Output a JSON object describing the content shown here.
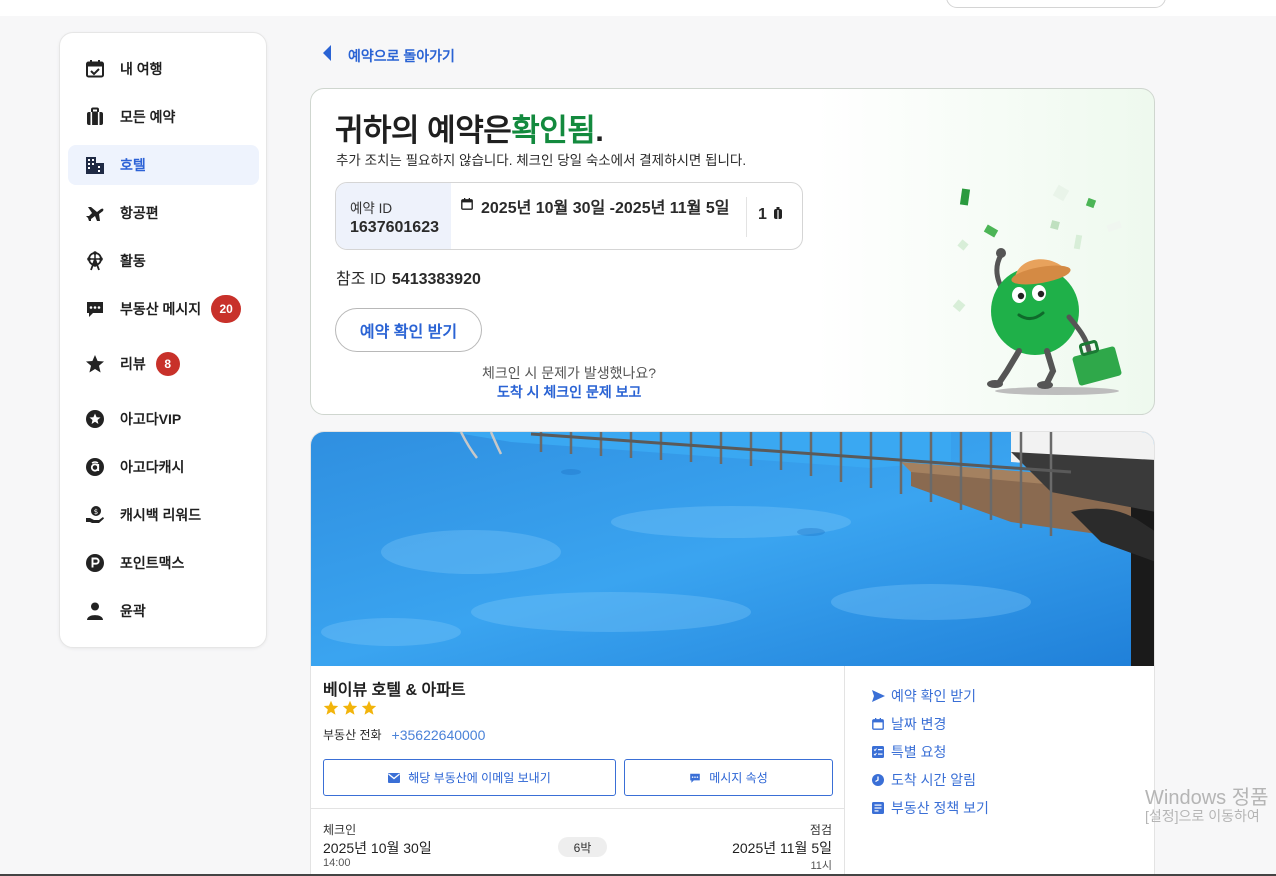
{
  "sidebar": {
    "items": [
      {
        "label": "내 여행",
        "icon": "calendar-check-icon"
      },
      {
        "label": "모든 예약",
        "icon": "suitcase-icon"
      },
      {
        "label": "호텔",
        "icon": "hotel-building-icon",
        "active": true
      },
      {
        "label": "항공편",
        "icon": "airplane-icon"
      },
      {
        "label": "활동",
        "icon": "ferris-wheel-icon"
      },
      {
        "label": "부동산 메시지",
        "icon": "chat-bubble-icon",
        "badge": "20"
      },
      {
        "label": "리뷰",
        "icon": "star-icon",
        "badge": "8"
      },
      {
        "label": "아고다VIP",
        "icon": "vip-star-circle-icon"
      },
      {
        "label": "아고다캐시",
        "icon": "agoda-cash-icon"
      },
      {
        "label": "캐시백 리워드",
        "icon": "cashback-hand-icon"
      },
      {
        "label": "포인트맥스",
        "icon": "pointsmax-icon"
      },
      {
        "label": "윤곽",
        "icon": "person-icon"
      }
    ]
  },
  "back_link": {
    "label": "예약으로 돌아가기"
  },
  "confirmation": {
    "title_prefix": "귀하의 예약은",
    "title_status": "확인됨",
    "title_suffix": ".",
    "subtitle": "추가 조치는 필요하지 않습니다. 체크인 당일 숙소에서 결제하시면 됩니다.",
    "booking_id_label": "예약 ID",
    "booking_id": "1637601623",
    "dates": "2025년 10월 30일 -2025년 11월 5일",
    "guests": "1",
    "reference_label": "참조 ID",
    "reference_id": "5413383920",
    "get_confirmation_button": "예약 확인 받기",
    "issue_question": "체크인 시 문제가 발생했나요?",
    "issue_link": "도착 시 체크인 문제 보고"
  },
  "hotel": {
    "name": "베이뷰 호텔 & 아파트",
    "stars": 3,
    "phone_label": "부동산 전화",
    "phone": "+35622640000",
    "email_button": "해당 부동산에 이메일 보내기",
    "message_button": "메시지 속성",
    "actions": [
      {
        "label": "예약 확인 받기",
        "icon": "send-icon"
      },
      {
        "label": "날짜 변경",
        "icon": "calendar-icon"
      },
      {
        "label": "특별 요청",
        "icon": "checklist-icon"
      },
      {
        "label": "도착 시간 알림",
        "icon": "clock-icon"
      },
      {
        "label": "부동산 정책 보기",
        "icon": "policy-doc-icon"
      }
    ],
    "checkin_label": "체크인",
    "checkin_date": "2025년 10월 30일",
    "checkin_time": "14:00",
    "nights": "6박",
    "checkout_label": "점검",
    "checkout_date": "2025년 11월 5일",
    "checkout_time": "11시"
  },
  "watermark": {
    "line1": "Windows 정품",
    "line2": "[설정]으로 이동하여"
  },
  "colors": {
    "accent_blue": "#2a63d4",
    "confirmed_green": "#138a3e",
    "badge_red": "#c8312a",
    "star_gold": "#f2b40b"
  }
}
